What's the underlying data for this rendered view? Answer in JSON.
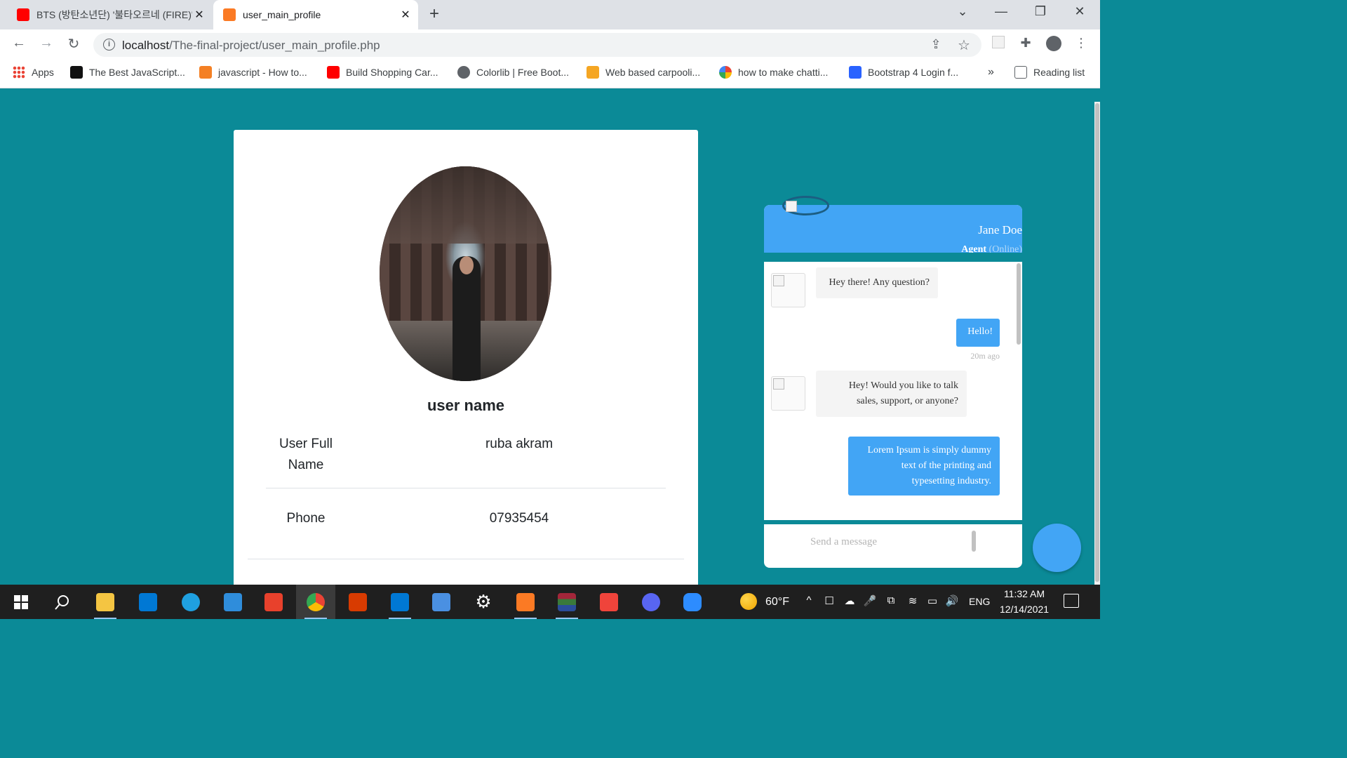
{
  "browser": {
    "tabs": [
      {
        "title": "BTS (방탄소년단) '불타오르네 (FIRE)' Official MV",
        "favicon": "youtube-icon",
        "color": "#ff0000",
        "active": false
      },
      {
        "title": "user_main_profile",
        "favicon": "xampp-icon",
        "color": "#fb7a24",
        "active": true
      }
    ],
    "new_tab_glyph": "+",
    "window_controls": {
      "dropdown": "⌄",
      "minimize": "—",
      "restore": "❐",
      "close": "✕"
    },
    "tab_close_glyph": "✕",
    "nav_glyphs": {
      "back": "←",
      "forward": "→",
      "reload": "↻"
    },
    "url": {
      "host": "localhost",
      "path": "/The-final-project/user_main_profile.php"
    },
    "toolbar_glyphs": {
      "share": "⇪",
      "bookmark": "☆",
      "extensions": "✚",
      "menu": "⋮"
    },
    "bookmarks": [
      {
        "label": "Apps",
        "icon": "apps-grid-icon",
        "color": "#4285f4"
      },
      {
        "label": "The Best JavaScript...",
        "icon": "jsbin-icon",
        "color": "#111111"
      },
      {
        "label": "javascript - How to...",
        "icon": "stackoverflow-icon",
        "color": "#f48024"
      },
      {
        "label": "Build Shopping Car...",
        "icon": "youtube-icon",
        "color": "#ff0000"
      },
      {
        "label": "Colorlib | Free Boot...",
        "icon": "globe-icon",
        "color": "#5f6368"
      },
      {
        "label": "Web based carpooli...",
        "icon": "carpool-icon",
        "color": "#f5a623"
      },
      {
        "label": "how to make chatti...",
        "icon": "google-icon",
        "color": "#4285f4"
      },
      {
        "label": "Bootstrap 4 Login f...",
        "icon": "bootstrap-icon",
        "color": "#2962ff"
      }
    ],
    "bookmarks_overflow": "»",
    "reading_list": "Reading list"
  },
  "profile": {
    "user_name": "user name",
    "fields": [
      {
        "label": "User Full Name",
        "value": "ruba akram"
      },
      {
        "label": "Phone",
        "value": "07935454"
      }
    ]
  },
  "chat": {
    "agent_name": "Jane Doe",
    "agent_role": "Agent",
    "agent_status": "(Online)",
    "messages": [
      {
        "from": "agent",
        "text": "Hey there! Any question?"
      },
      {
        "from": "user",
        "text": "Hello!",
        "time": "20m ago"
      },
      {
        "from": "agent",
        "text": "Hey! Would you like to talk sales, support, or anyone?"
      },
      {
        "from": "user",
        "text": "Lorem Ipsum is simply dummy text of the printing and typesetting industry."
      }
    ],
    "input_placeholder": "Send a message"
  },
  "taskbar": {
    "apps": [
      {
        "name": "start-button",
        "color": "#ffffff"
      },
      {
        "name": "search-button",
        "color": "#ffffff"
      },
      {
        "name": "file-explorer",
        "color": "#f4c542"
      },
      {
        "name": "microsoft-store",
        "color": "#0078d4"
      },
      {
        "name": "edge",
        "color": "#1fa0e0"
      },
      {
        "name": "mail",
        "color": "#2f8ddb"
      },
      {
        "name": "office",
        "color": "#e8412c"
      },
      {
        "name": "chrome",
        "color": "#34a853"
      },
      {
        "name": "office-2",
        "color": "#d83b01"
      },
      {
        "name": "vscode",
        "color": "#0078d4"
      },
      {
        "name": "photos",
        "color": "#4a90e2"
      },
      {
        "name": "settings",
        "color": "#ffffff"
      },
      {
        "name": "xampp",
        "color": "#fb7a24"
      },
      {
        "name": "winrar",
        "color": "#a3263a"
      },
      {
        "name": "anydesk",
        "color": "#ef443b"
      },
      {
        "name": "discord",
        "color": "#5865f2"
      },
      {
        "name": "zoom",
        "color": "#2d8cff"
      }
    ],
    "weather": "60°F",
    "tray_glyphs": [
      "^",
      "☐",
      "☁",
      "🎤",
      "⧉",
      "≋",
      "▭",
      "🔊"
    ],
    "language": "ENG",
    "time": "11:32 AM",
    "date": "12/14/2021"
  }
}
